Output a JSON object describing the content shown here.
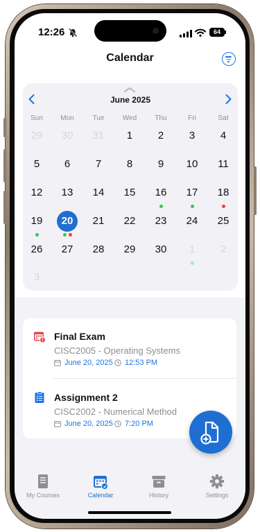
{
  "status_bar": {
    "time": "12:26",
    "battery": "64"
  },
  "header": {
    "title": "Calendar",
    "filter_icon": "filter-icon"
  },
  "calendar": {
    "month_label": "June 2025",
    "weekdays": [
      "Sun",
      "Mon",
      "Tue",
      "Wed",
      "Thu",
      "Fri",
      "Sat"
    ],
    "weeks": [
      [
        "29",
        "30",
        "31",
        "1",
        "2",
        "3",
        "4"
      ],
      [
        "5",
        "6",
        "7",
        "8",
        "9",
        "10",
        "11"
      ],
      [
        "12",
        "13",
        "14",
        "15",
        "16",
        "17",
        "18"
      ],
      [
        "19",
        "20",
        "21",
        "22",
        "23",
        "24",
        "25"
      ],
      [
        "26",
        "27",
        "28",
        "29",
        "30",
        "1",
        "2"
      ],
      [
        "3"
      ]
    ],
    "selected_day": "20",
    "event_colors": {
      "green": "#34c759",
      "red": "#ff3b30",
      "faded_green": "#a8e6b8"
    }
  },
  "events": [
    {
      "icon": "exam-calendar-icon",
      "title": "Final Exam",
      "course": "CISC2005 - Operating Systems",
      "date": "June 20, 2025",
      "time": "12:53 PM"
    },
    {
      "icon": "clipboard-icon",
      "title": "Assignment 2",
      "course": "CISC2002 - Numerical Method",
      "date": "June 20, 2025",
      "time": "7:20 PM"
    }
  ],
  "fab": {
    "icon": "add-document-icon"
  },
  "tabs": [
    {
      "label": "My Courses",
      "icon": "book-icon"
    },
    {
      "label": "Calendar",
      "icon": "calendar-icon",
      "active": true
    },
    {
      "label": "History",
      "icon": "archive-box-icon"
    },
    {
      "label": "Settings",
      "icon": "gear-icon"
    }
  ],
  "colors": {
    "accent": "#1e6fd1",
    "background": "#f2f2f7"
  }
}
